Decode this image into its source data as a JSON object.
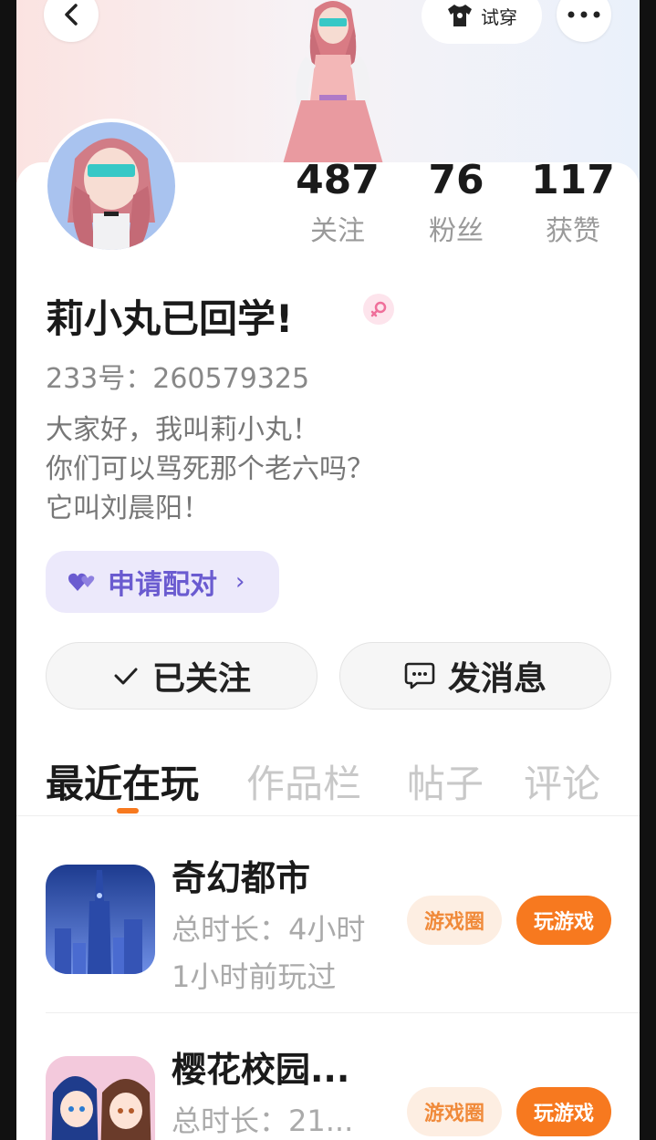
{
  "header": {
    "tryon_label": "试穿",
    "back_icon": "chevron-left-icon",
    "more_icon": "more-dots-icon",
    "tryon_icon": "tshirt-icon"
  },
  "stats": [
    {
      "value": "487",
      "label": "关注"
    },
    {
      "value": "76",
      "label": "粉丝"
    },
    {
      "value": "117",
      "label": "获赞"
    }
  ],
  "profile": {
    "name": "莉小丸已回学!",
    "gender_icon": "female-icon",
    "uid": "233号：260579325",
    "bio": [
      "大家好，我叫莉小丸！",
      "你们可以骂死那个老六吗？",
      "它叫刘晨阳！"
    ]
  },
  "pair_button": {
    "label": "申请配对",
    "chevron": "›"
  },
  "actions": {
    "follow_label": "已关注",
    "message_label": "发消息"
  },
  "tabs": [
    "最近在玩",
    "作品栏",
    "帖子",
    "评论"
  ],
  "games": [
    {
      "title": "奇幻都市",
      "duration": "总时长：4小时",
      "last_played": "1小时前玩过",
      "circle_label": "游戏圈",
      "play_label": "玩游戏"
    },
    {
      "title": "樱花校园...",
      "duration": "总时长：21...",
      "circle_label": "游戏圈",
      "play_label": "玩游戏"
    }
  ],
  "colors": {
    "accent_orange": "#f7791f",
    "pair_purple": "#6a5bd0",
    "pair_bg": "#ece9fb"
  }
}
